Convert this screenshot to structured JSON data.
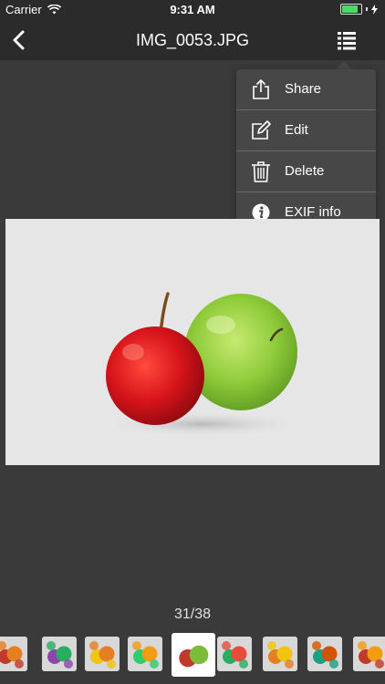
{
  "status_bar": {
    "carrier": "Carrier",
    "time": "9:31 AM",
    "battery_level": 0.85,
    "icons": [
      "wifi-icon",
      "battery-icon",
      "charging-bolt-icon"
    ]
  },
  "nav_bar": {
    "title": "IMG_0053.JPG",
    "back_icon": "chevron-left-icon",
    "menu_icon": "list-menu-icon"
  },
  "menu": {
    "items": [
      {
        "label": "Share",
        "icon": "share-icon"
      },
      {
        "label": "Edit",
        "icon": "edit-icon"
      },
      {
        "label": "Delete",
        "icon": "trash-icon"
      },
      {
        "label": "EXIF info",
        "icon": "info-icon"
      }
    ]
  },
  "photo": {
    "subject": "red and green apples"
  },
  "gallery": {
    "counter": "31/38",
    "thumbnails": [
      {
        "name": "thumb-fruit-1",
        "colors": [
          "#c0392b",
          "#e67e22"
        ]
      },
      {
        "name": "thumb-fruit-2",
        "colors": [
          "#8e44ad",
          "#27ae60"
        ]
      },
      {
        "name": "thumb-fruit-3",
        "colors": [
          "#f1c40f",
          "#e67e22"
        ]
      },
      {
        "name": "thumb-fruit-4",
        "colors": [
          "#2ecc71",
          "#f39c12"
        ]
      },
      {
        "name": "thumb-apples-selected",
        "colors": [
          "#c0392b",
          "#7dbb3a"
        ]
      },
      {
        "name": "thumb-fruit-6",
        "colors": [
          "#27ae60",
          "#e74c3c"
        ]
      },
      {
        "name": "thumb-fruit-7",
        "colors": [
          "#e67e22",
          "#f1c40f"
        ]
      },
      {
        "name": "thumb-fruit-8",
        "colors": [
          "#16a085",
          "#d35400"
        ]
      },
      {
        "name": "thumb-fruit-9",
        "colors": [
          "#c0392b",
          "#f39c12"
        ]
      }
    ],
    "selected_index": 4
  }
}
